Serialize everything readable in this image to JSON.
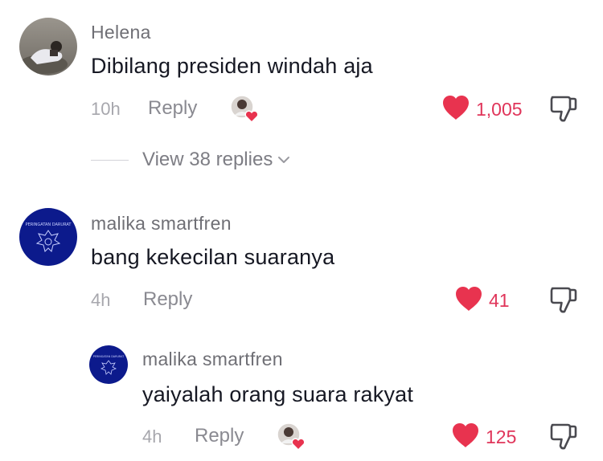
{
  "comments": [
    {
      "username": "Helena",
      "text": "Dibilang presiden windah aja",
      "time": "10h",
      "reply_label": "Reply",
      "likes": "1,005",
      "view_replies": "View 38 replies"
    },
    {
      "username": "malika smartfren",
      "text": "bang kekecilan suaranya",
      "time": "4h",
      "reply_label": "Reply",
      "likes": "41",
      "avatar_text": "PERINGATAN DARURAT"
    },
    {
      "username": "malika smartfren",
      "text": "yaiyalah orang suara rakyat",
      "time": "4h",
      "reply_label": "Reply",
      "likes": "125",
      "avatar_text": "PERINGATAN DARURAT"
    }
  ],
  "colors": {
    "like_red": "#e8334f",
    "avatar_navy": "#0c1a8c",
    "username_gray": "#6f6f75",
    "text_dark": "#161823"
  },
  "icons": [
    "heart-icon",
    "dislike-icon",
    "chevron-down-icon",
    "creator-liked-avatar"
  ]
}
